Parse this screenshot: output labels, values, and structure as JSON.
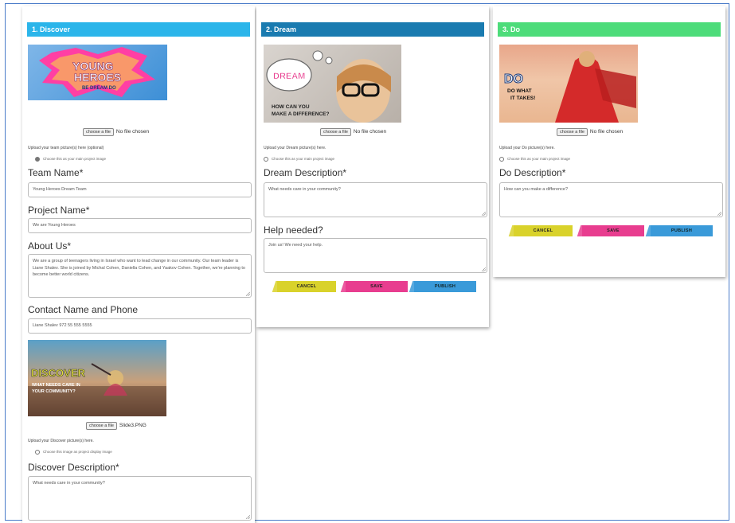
{
  "columns": {
    "discover": {
      "header": "1. Discover",
      "header_color": "#2bb5ea",
      "image1_text": {
        "line1": "YOUNG",
        "line2": "HEROES",
        "line3": "BE DREAM DO"
      },
      "choose_file": "choose a file",
      "no_file": "No file chosen",
      "upload_hint": "Upload your team picture(s) here (optional)",
      "main_image_option": "Choose this as your main project image",
      "team_name_label": "Team Name*",
      "team_name_value": "Young Heroes Dream Team",
      "project_name_label": "Project Name*",
      "project_name_value": "We are Young Heroes",
      "about_label": "About Us*",
      "about_value": "We are a group of teenagers living in Israel who want to lead change in our community. Our team leader is Liane Shalev. She is joined by Michal Cohen, Daniella Cohen, and Yaakov Cohen. Together, we're planning to become better world citizens.",
      "contact_label": "Contact Name and Phone",
      "contact_value": "Liane Shalev 972 55 555 5555",
      "image2_text": {
        "title": "DISCOVER",
        "sub1": "WHAT NEEDS CARE IN",
        "sub2": "YOUR COMMUNITY?"
      },
      "choose_file2": "choose a file",
      "file2_name": "Slide3.PNG",
      "upload_hint2": "Upload your Discover picture(s) here.",
      "main_image_option2": "Choose this image as project display image",
      "discover_desc_label": "Discover Description*",
      "discover_desc_placeholder": "What needs care in your community?"
    },
    "dream": {
      "header": "2. Dream",
      "header_color": "#1a7bb0",
      "image_text": {
        "bubble": "DREAM",
        "line1": "HOW CAN YOU",
        "line2": "MAKE A DIFFERENCE?"
      },
      "choose_file": "choose a file",
      "no_file": "No file chosen",
      "upload_hint": "Upload your Dream picture(s) here.",
      "main_image_option": "Choose this as your main project image",
      "desc_label": "Dream Description*",
      "desc_placeholder": "What needs care in your community?",
      "help_label": "Help needed?",
      "help_placeholder": "Join us! We need your help.",
      "cancel": "CANCEL",
      "save": "SAVE",
      "publish": "PUBLISH"
    },
    "do": {
      "header": "3. Do",
      "header_color": "#4ddc7a",
      "image_text": {
        "title": "DO",
        "line1": "DO WHAT",
        "line2": "IT TAKES!"
      },
      "choose_file": "choose a file",
      "no_file": "No file chosen",
      "upload_hint": "Upload your Do picture(s) here.",
      "main_image_option": "Choose this as your main project image",
      "desc_label": "Do Description*",
      "desc_placeholder": "How can you make a difference?",
      "cancel": "CANCEL",
      "save": "SAVE",
      "publish": "PUBLISH"
    }
  }
}
